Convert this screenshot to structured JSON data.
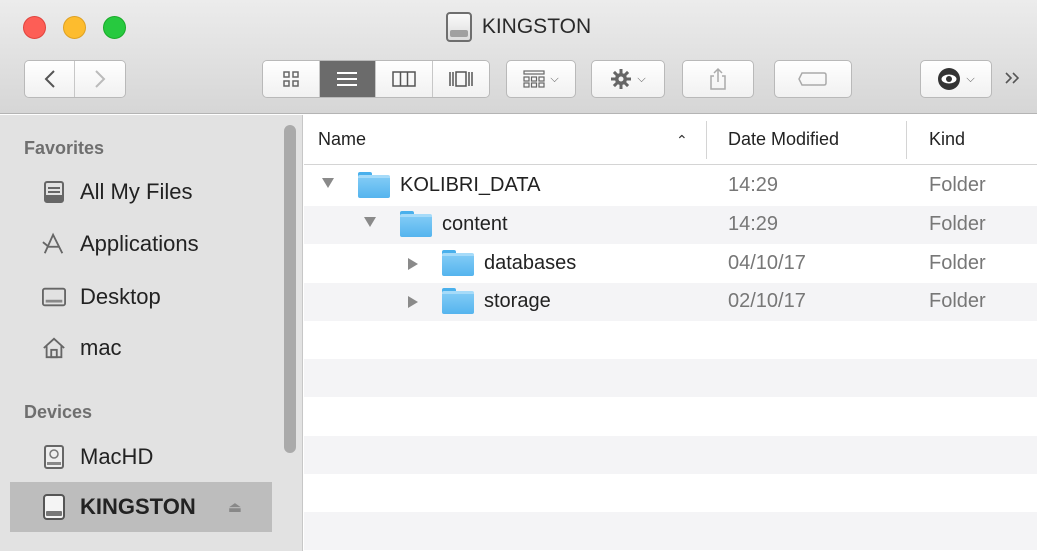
{
  "window": {
    "title": "KINGSTON",
    "title_icon": "drive-icon"
  },
  "toolbar": {
    "back_icon": "‹",
    "forward_icon": "›",
    "view_icon_glyph": "▫",
    "more_glyph": "»"
  },
  "sidebar": {
    "favorites_heading": "Favorites",
    "favorites": [
      {
        "label": "All My Files",
        "icon": "all-files-icon"
      },
      {
        "label": "Applications",
        "icon": "applications-icon"
      },
      {
        "label": "Desktop",
        "icon": "desktop-icon"
      },
      {
        "label": "mac",
        "icon": "home-icon"
      }
    ],
    "devices_heading": "Devices",
    "devices": [
      {
        "label": "MacHD",
        "icon": "hard-disk-icon"
      },
      {
        "label": "KINGSTON",
        "icon": "external-drive-icon",
        "selected": true
      }
    ]
  },
  "columns": {
    "name": "Name",
    "date_modified": "Date Modified",
    "kind": "Kind"
  },
  "files": [
    {
      "name": "KOLIBRI_DATA",
      "date": "14:29",
      "kind": "Folder",
      "expanded": true,
      "depth": 0
    },
    {
      "name": "content",
      "date": "14:29",
      "kind": "Folder",
      "expanded": true,
      "depth": 1
    },
    {
      "name": "databases",
      "date": "04/10/17",
      "kind": "Folder",
      "expanded": false,
      "depth": 2
    },
    {
      "name": "storage",
      "date": "02/10/17",
      "kind": "Folder",
      "expanded": false,
      "depth": 2
    }
  ]
}
